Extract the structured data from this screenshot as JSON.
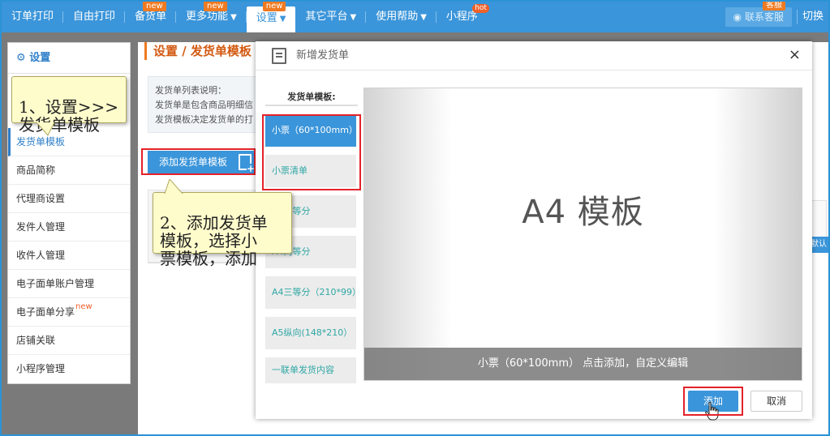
{
  "nav": {
    "items": [
      {
        "label": "订单打印"
      },
      {
        "label": "自由打印"
      },
      {
        "label": "备货单",
        "badge": "new"
      },
      {
        "label": "更多功能",
        "badge": "new",
        "arrow": "▼"
      },
      {
        "label": "设置",
        "badge": "new",
        "arrow": "▼",
        "active": true
      },
      {
        "label": "其它平台",
        "arrow": "▼"
      },
      {
        "label": "使用帮助",
        "arrow": "▼"
      },
      {
        "label": "小程序",
        "badge": "hot"
      }
    ],
    "kefu_label": "联系客服",
    "kefu_badge": "客服",
    "switch_label": "切换"
  },
  "sidebar": {
    "title": "设置",
    "items": [
      {
        "label": "发货单模板",
        "active": true
      },
      {
        "label": "商品简称"
      },
      {
        "label": "代理商设置"
      },
      {
        "label": "发件人管理"
      },
      {
        "label": "收件人管理"
      },
      {
        "label": "电子面单账户管理"
      },
      {
        "label": "电子面单分享",
        "badge": "new"
      },
      {
        "label": "店铺关联"
      },
      {
        "label": "小程序管理"
      }
    ]
  },
  "main": {
    "title": "设置 / 发货单模板",
    "info_lines": [
      "发货单列表说明：",
      "发货单是包含商品明细信",
      "发货模板决定发货单的打"
    ],
    "add_template_label": "添加发货单模板",
    "default_label": "默认"
  },
  "callouts": {
    "step1": "1、设置>>>\n发货单模板",
    "step2": "2、添加发货单\n模板，选择小\n票模板，添加"
  },
  "modal": {
    "title": "新增发货单",
    "close": "×",
    "list_label": "发货单模板:",
    "templates": [
      {
        "label": "小票（60*100mm）",
        "selected": true
      },
      {
        "label": "小票清单"
      },
      {
        "label": "A4三等分"
      },
      {
        "label": "A4两等分"
      },
      {
        "label": "A4三等分（210*99）"
      },
      {
        "label": "A5纵向(148*210）"
      },
      {
        "label": "一联单发货内容"
      }
    ],
    "preview_text": "A4 模板",
    "preview_caption": "小票（60*100mm）  点击添加，自定义编辑",
    "add_label": "添加",
    "cancel_label": "取消"
  },
  "colors": {
    "brand_blue": "#3b95da",
    "highlight_red": "#e4222a",
    "badge_orange": "#ef7a21",
    "callout_yellow": "#fffccc"
  }
}
